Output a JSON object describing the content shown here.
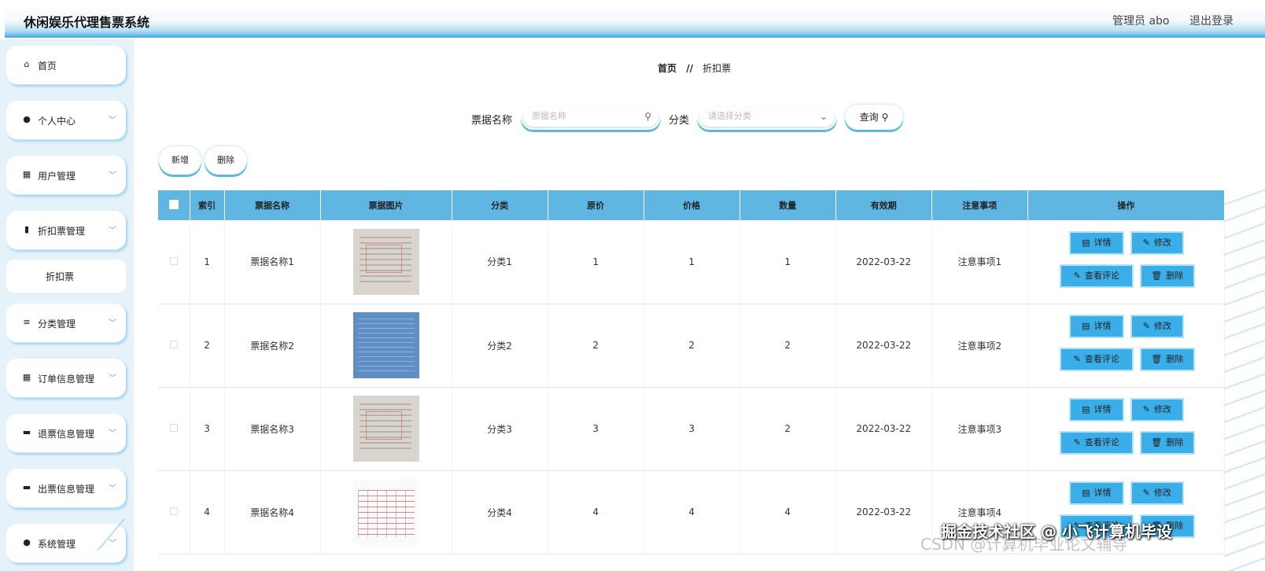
{
  "header": {
    "app_title": "休闲娱乐代理售票系统",
    "admin": "管理员 abo",
    "logout": "退出登录"
  },
  "sidebar": {
    "items": [
      {
        "label": "首页",
        "icon": "home-icon",
        "glyph": "⌂",
        "has_chevron": false
      },
      {
        "label": "个人中心",
        "icon": "user-icon",
        "glyph": "●",
        "has_chevron": true
      },
      {
        "label": "用户管理",
        "icon": "grid-icon",
        "glyph": "▦",
        "has_chevron": true
      },
      {
        "label": "折扣票管理",
        "icon": "bar-icon",
        "glyph": "▮",
        "has_chevron": true
      },
      {
        "label": "分类管理",
        "icon": "list-icon",
        "glyph": "≡",
        "has_chevron": true
      },
      {
        "label": "订单信息管理",
        "icon": "grid-icon",
        "glyph": "▦",
        "has_chevron": true
      },
      {
        "label": "退票信息管理",
        "icon": "monitor-icon",
        "glyph": "▬",
        "has_chevron": true
      },
      {
        "label": "出票信息管理",
        "icon": "print-icon",
        "glyph": "▬",
        "has_chevron": true
      },
      {
        "label": "系统管理",
        "icon": "user-icon",
        "glyph": "●",
        "has_chevron": true
      }
    ],
    "sub_item": "折扣票",
    "chevron": "﹀"
  },
  "breadcrumb": {
    "home": "首页",
    "sep": "//",
    "current": "折扣票"
  },
  "search": {
    "name_label": "票据名称",
    "name_placeholder": "票据名称",
    "category_label": "分类",
    "category_placeholder": "请选择分类",
    "query_label": "查询",
    "search_glyph": "⚲",
    "dropdown_glyph": "⌄"
  },
  "actions": {
    "add": "新增",
    "delete": "删除"
  },
  "table": {
    "headers": [
      "索引",
      "票据名称",
      "票据图片",
      "分类",
      "原价",
      "价格",
      "数量",
      "有效期",
      "注意事项",
      "操作"
    ],
    "op_labels": {
      "detail": "详情",
      "edit": "修改",
      "comments": "查看评论",
      "delete": "删除"
    },
    "op_glyphs": {
      "detail": "▤",
      "edit": "✎",
      "comments": "✎",
      "delete": "🗑"
    },
    "rows": [
      {
        "index": "1",
        "name": "票据名称1",
        "category": "分类1",
        "original_price": "1",
        "price": "1",
        "quantity": "1",
        "valid_until": "2022-03-22",
        "notes": "注意事项1"
      },
      {
        "index": "2",
        "name": "票据名称2",
        "category": "分类2",
        "original_price": "2",
        "price": "2",
        "quantity": "2",
        "valid_until": "2022-03-22",
        "notes": "注意事项2"
      },
      {
        "index": "3",
        "name": "票据名称3",
        "category": "分类3",
        "original_price": "3",
        "price": "3",
        "quantity": "2",
        "valid_until": "2022-03-22",
        "notes": "注意事项3"
      },
      {
        "index": "4",
        "name": "票据名称4",
        "category": "分类4",
        "original_price": "4",
        "price": "4",
        "quantity": "4",
        "valid_until": "2022-03-22",
        "notes": "注意事项4"
      }
    ]
  },
  "watermark": {
    "line1": "掘金技术社区 @ 小飞计算机毕设",
    "line2": "CSDN @计算机毕业论文辅导"
  },
  "colors": {
    "accent": "#5fb6e3",
    "button": "#3aaee8",
    "sidebar_bg": "#e6f2fa"
  }
}
